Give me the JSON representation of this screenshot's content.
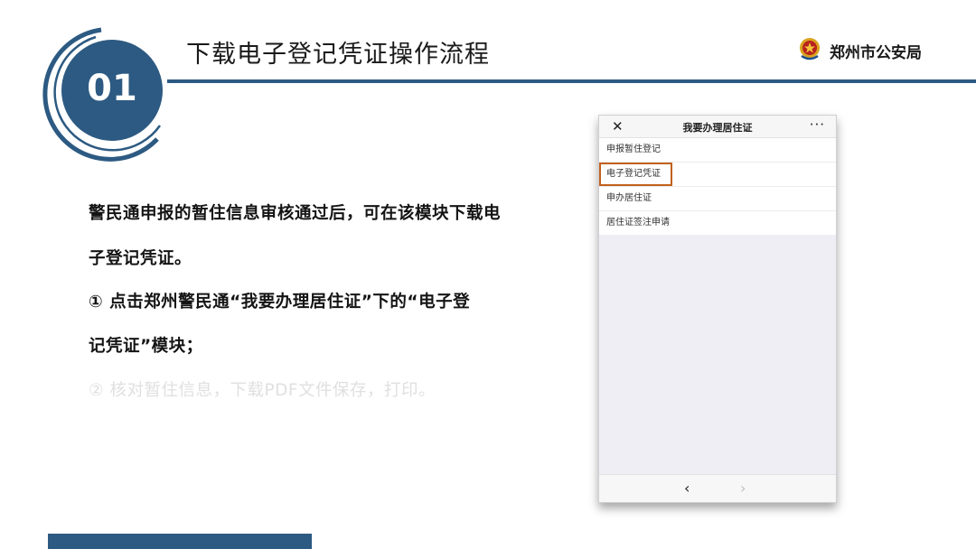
{
  "header": {
    "badge_number": "01",
    "title": "下载电子登记凭证操作流程",
    "brand": "郑州市公安局"
  },
  "content": {
    "line1": "警民通申报的暂住信息审核通过后，可在该模块下载电",
    "line2": "子登记凭证。",
    "line3": "① 点击郑州警民通“我要办理居住证”下的“电子登",
    "line4": "记凭证”模块；",
    "line5": "② 核对暂住信息，下载PDF文件保存，打印。"
  },
  "phone": {
    "nav_title": "我要办理居住证",
    "close_glyph": "✕",
    "more_glyph": "···",
    "items": [
      {
        "label": "申报暂住登记"
      },
      {
        "label": "电子登记凭证"
      },
      {
        "label": "申办居住证"
      },
      {
        "label": "居住证签注申请"
      }
    ],
    "back_glyph": "‹",
    "forward_glyph": "›"
  },
  "colors": {
    "primary": "#2d5a82",
    "highlight": "#c2611b"
  }
}
